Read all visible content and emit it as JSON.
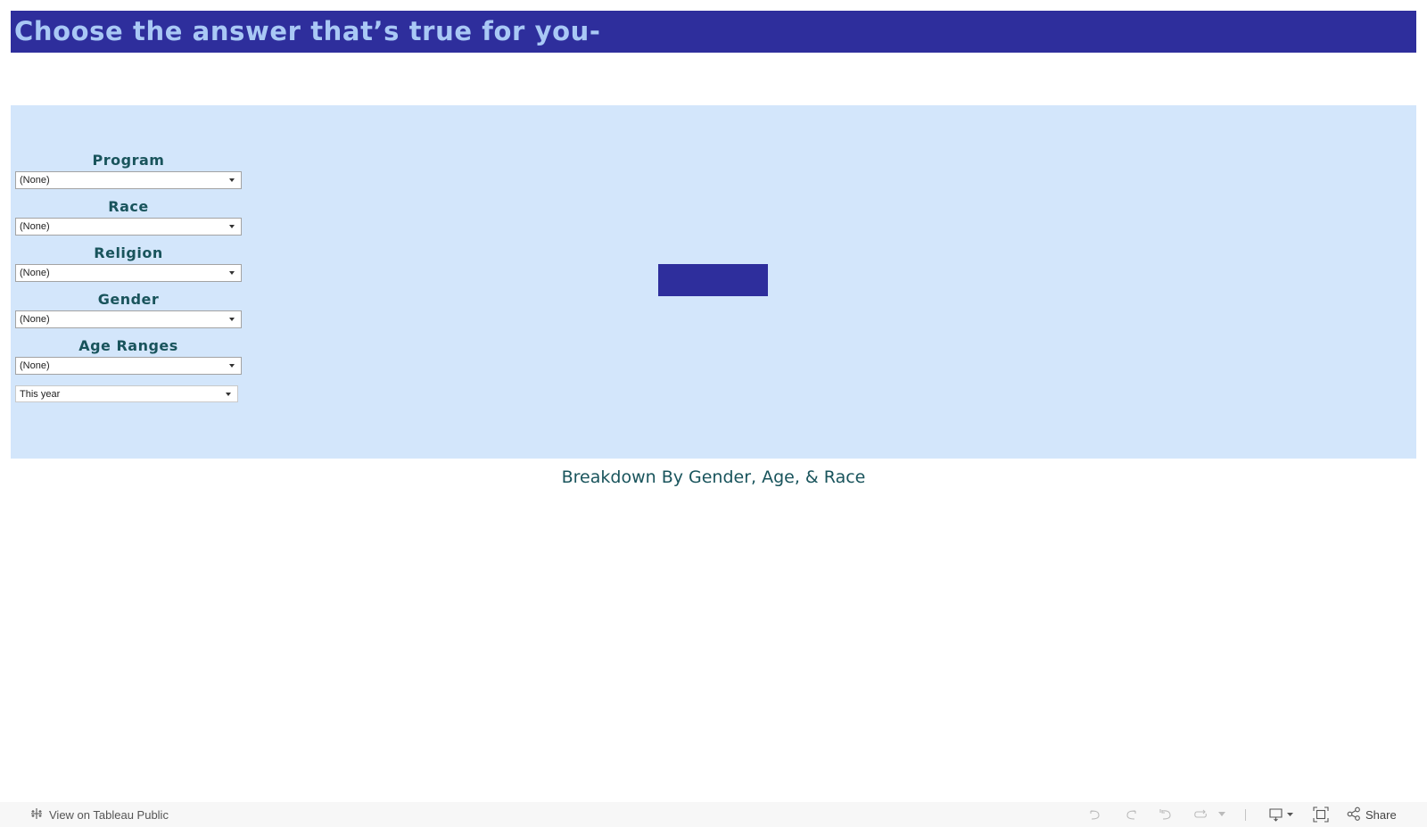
{
  "header": {
    "title": "Choose the answer that’s true for you-"
  },
  "colors": {
    "header_bg": "#2e2e9c",
    "header_text": "#a9c8f5",
    "panel_bg": "#d3e6fb",
    "label_text": "#19545c"
  },
  "filters": [
    {
      "label": "Program",
      "value": "(None)"
    },
    {
      "label": "Race",
      "value": "(None)"
    },
    {
      "label": "Religion",
      "value": "(None)"
    },
    {
      "label": "Gender",
      "value": "(None)"
    },
    {
      "label": "Age Ranges",
      "value": "(None)"
    }
  ],
  "date_filter": {
    "value": "This year"
  },
  "section": {
    "title": "Breakdown By Gender, Age, & Race"
  },
  "toolbar": {
    "view_on_label": "View on Tableau Public",
    "share_label": "Share",
    "icons": [
      "tableau-logo-icon",
      "undo-icon",
      "redo-icon",
      "revert-icon",
      "refresh-icon",
      "refresh-dropdown-icon",
      "download-icon",
      "fullscreen-icon",
      "share-icon"
    ]
  }
}
